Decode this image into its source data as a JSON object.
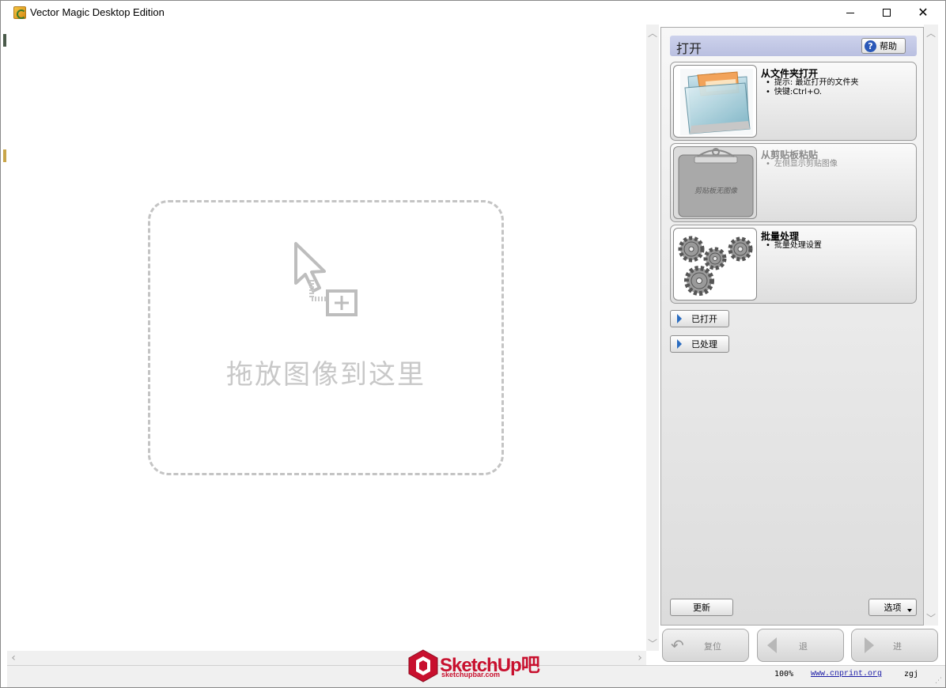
{
  "window": {
    "title": "Vector Magic Desktop Edition"
  },
  "canvas": {
    "drop_text": "拖放图像到这里"
  },
  "panel": {
    "title": "打开",
    "help_label": "帮助",
    "cards": [
      {
        "title": "从文件夹打开",
        "bullets": [
          "提示: 最近打开的文件夹",
          "快键:Ctrl+O."
        ],
        "enabled": true
      },
      {
        "title": "从剪贴板粘贴",
        "bullets": [
          "左侧显示剪贴图像"
        ],
        "enabled": false,
        "thumb_caption": "剪贴板无图像"
      },
      {
        "title": "批量处理",
        "bullets": [
          "批量处理设置"
        ],
        "enabled": true
      }
    ],
    "expanders": {
      "opened": "已打开",
      "processed": "已处理"
    },
    "update_label": "更新",
    "options_label": "选项"
  },
  "nav": {
    "reset": "复位",
    "back": "退",
    "next": "进"
  },
  "status": {
    "zoom": "100%",
    "link": "www.cnprint.org",
    "user": "zgj"
  },
  "watermark": {
    "brand": "SketchUp吧",
    "site": "sketchupbar.com"
  },
  "colors": {
    "panel_header": "#c3c8e6",
    "help_icon": "#2a58b8",
    "expander_arrow": "#2a6cc0",
    "link": "#1a1aa6",
    "watermark": "#c8102e"
  }
}
